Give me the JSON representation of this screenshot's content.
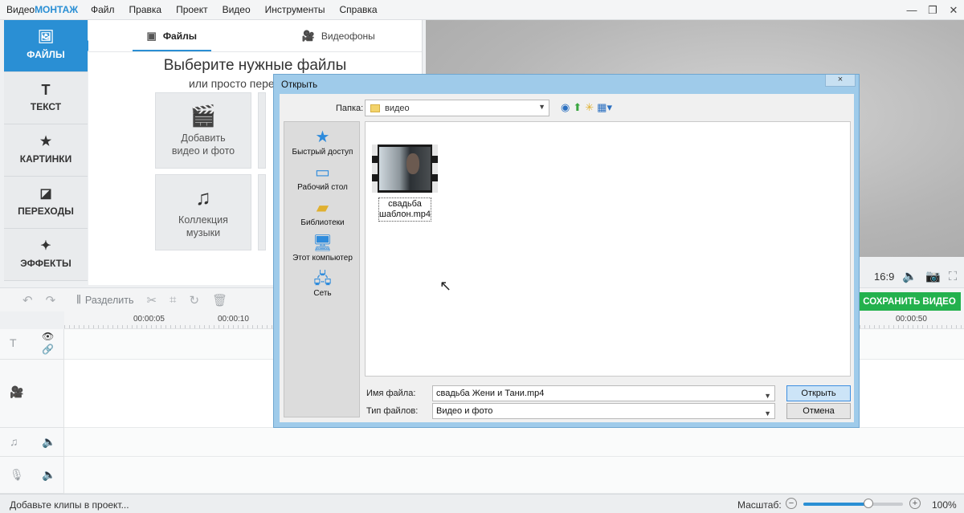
{
  "app": {
    "title_prefix": "Видео",
    "title_accent": "МОНТАЖ",
    "menu": [
      "Файл",
      "Правка",
      "Проект",
      "Видео",
      "Инструменты",
      "Справка"
    ]
  },
  "sidebar": {
    "items": [
      {
        "label": "ФАЙЛЫ",
        "icon": "image-icon"
      },
      {
        "label": "ТЕКСТ",
        "icon": "text-icon"
      },
      {
        "label": "КАРТИНКИ",
        "icon": "star-icon"
      },
      {
        "label": "ПЕРЕХОДЫ",
        "icon": "transitions-icon"
      },
      {
        "label": "ЭФФЕКТЫ",
        "icon": "magic-wand-icon"
      }
    ]
  },
  "library": {
    "tabs": [
      "Файлы",
      "Видеофоны"
    ],
    "heading": "Выберите нужные файлы",
    "subheading": "или просто перетащите в",
    "tiles": [
      {
        "label": "Добавить видео и фото"
      },
      {
        "label": "Коллекция музыки"
      }
    ]
  },
  "preview": {
    "aspect": "16:9"
  },
  "toolbar": {
    "split_label": "Разделить",
    "save_label": "СОХРАНИТЬ ВИДЕО"
  },
  "ruler": {
    "ticks": [
      "00:00:05",
      "00:00:10",
      "00:00:50"
    ]
  },
  "status": {
    "text": "Добавьте клипы в проект...",
    "zoom_label": "Масштаб:",
    "zoom_value": "100%",
    "zoom_fraction": 0.65
  },
  "dialog": {
    "title": "Открыть",
    "close": "×",
    "folder_label": "Папка:",
    "folder_value": "видео",
    "places": [
      "Быстрый доступ",
      "Рабочий стол",
      "Библиотеки",
      "Этот компьютер",
      "Сеть"
    ],
    "file": {
      "name_line1": "свадьба",
      "name_line2": "шаблон.mp4"
    },
    "filename_label": "Имя файла:",
    "filename_value": "свадьба Жени и Тани.mp4",
    "filetype_label": "Тип файлов:",
    "filetype_value": "Видео и фото",
    "open_button": "Открыть",
    "cancel_button": "Отмена"
  },
  "colors": {
    "accent": "#2a8fd4",
    "save_green": "#23b14d",
    "dialog_frame": "#9fcbea"
  }
}
